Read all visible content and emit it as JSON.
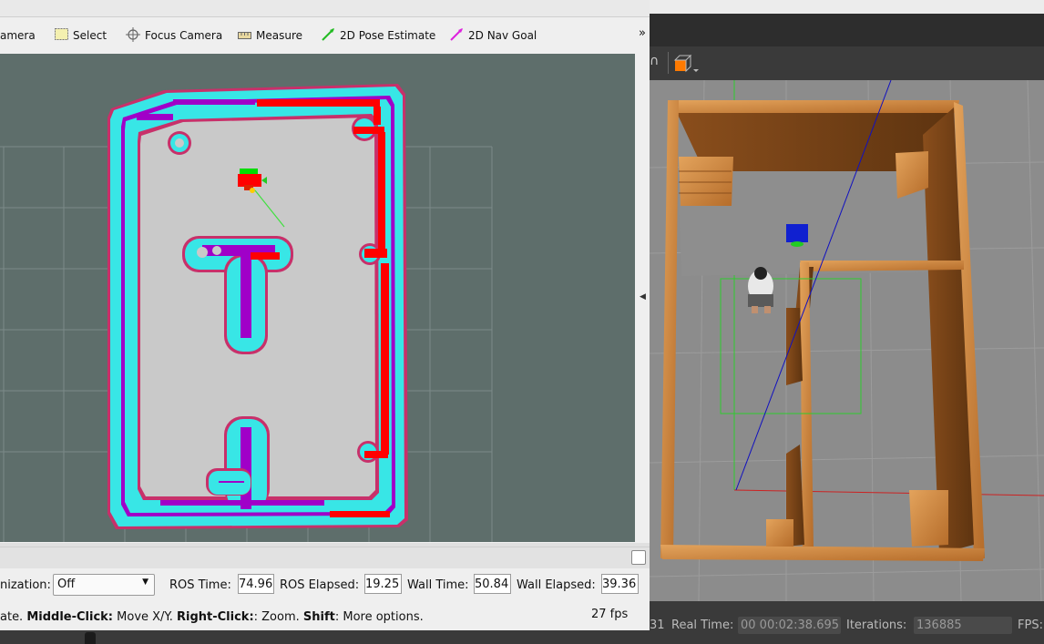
{
  "rviz": {
    "toolbar": {
      "interact_label_partial": "amera",
      "select_label": "Select",
      "focus_camera_label": "Focus Camera",
      "measure_label": "Measure",
      "pose_estimate_label": "2D Pose Estimate",
      "nav_goal_label": "2D Nav Goal",
      "more_label": "»"
    },
    "time_panel": {
      "sync_label_partial": "nization:",
      "sync_value": "Off",
      "ros_time_label": "ROS Time:",
      "ros_time": "74.96",
      "ros_elapsed_label": "ROS Elapsed:",
      "ros_elapsed": "19.25",
      "wall_time_label": "Wall Time:",
      "wall_time": "50.84",
      "wall_elapsed_label": "Wall Elapsed:",
      "wall_elapsed": "39.36"
    },
    "status": {
      "hint_prefix": "ate. ",
      "middle_click": "Middle-Click:",
      "middle_desc": " Move X/Y. ",
      "right_click": "Right-Click:",
      "right_desc": ": Zoom. ",
      "shift": "Shift",
      "shift_desc": ": More options.",
      "fps": "27 fps"
    },
    "colors": {
      "background": "#5e6e6b",
      "free_space": "#c9c9c9",
      "inflation": "#38e6e6",
      "lethal": "#b000c8",
      "obstacle": "#ff0000",
      "border": "#c8306a",
      "pose_arrow": "#00ff00",
      "nav_goal": "#ff00ff"
    }
  },
  "gazebo": {
    "status": {
      "sim_time_partial": "31",
      "real_time_label": "Real Time:",
      "real_time": "00 00:02:38.695",
      "iterations_label": "Iterations:",
      "iterations": "136885",
      "fps_label": "FPS:"
    },
    "colors": {
      "ground": "#8c8c8c",
      "wall": "#c8823f",
      "robot": "#1020d0",
      "box_outline": "#2ecc2e",
      "laser_line": "#1010c0"
    },
    "icons": {
      "translate": "magnet-icon",
      "shape": "box-shape-icon"
    }
  }
}
